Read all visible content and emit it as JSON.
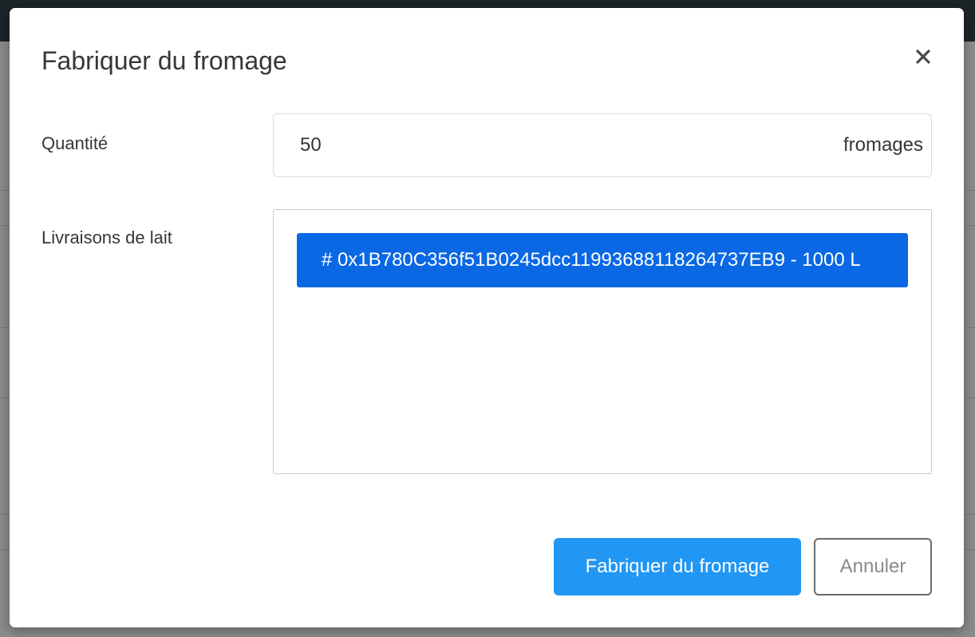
{
  "modal": {
    "title": "Fabriquer du fromage",
    "close_icon": "close-icon"
  },
  "form": {
    "quantity": {
      "label": "Quantité",
      "value": "50",
      "unit": "fromages"
    },
    "milk_deliveries": {
      "label": "Livraisons de lait",
      "options": [
        "# 0x1B780C356f51B0245dcc11993688118264737EB9 - 1000 L"
      ],
      "selected_index": 0
    }
  },
  "actions": {
    "submit_label": "Fabriquer du fromage",
    "cancel_label": "Annuler"
  },
  "colors": {
    "primary_button": "#2196f3",
    "selected_option": "#0a68e4",
    "backdrop": "#8c8c8c",
    "topbar": "#1b2428"
  }
}
